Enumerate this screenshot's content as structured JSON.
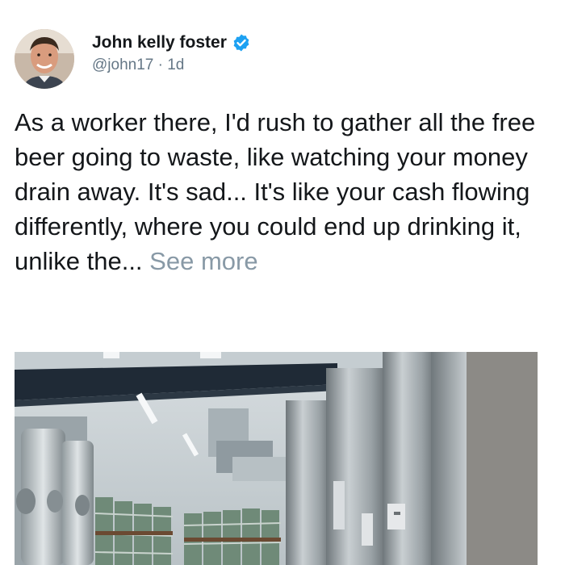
{
  "tweet": {
    "display_name": "John kelly foster",
    "verified_icon": "verified-badge-icon",
    "handle": "@john17",
    "separator": " · ",
    "time": "1d",
    "body": "As a worker there, I'd rush to gather all the free beer going to waste, like watching your money drain away. It's sad... It's like your cash flowing differently, where you could end up drinking it, unlike the...",
    "see_more": "See more",
    "colors": {
      "text": "#14171a",
      "secondary": "#657786",
      "see_more": "#8899a6",
      "verified": "#1da1f2"
    }
  }
}
